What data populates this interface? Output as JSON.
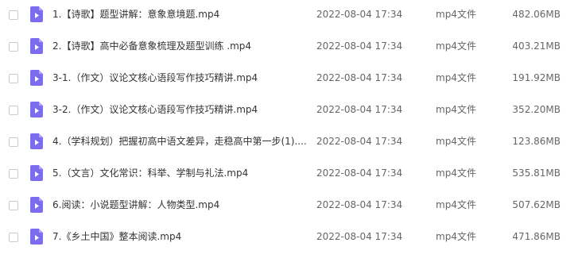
{
  "file_list": {
    "icon": "video-file-icon",
    "icon_color": "#7b6cf0",
    "rows": [
      {
        "name": "1.【诗歌】题型讲解：意象意境题.mp4",
        "date": "2022-08-04 17:34",
        "type": "mp4文件",
        "size": "482.06MB"
      },
      {
        "name": "2.【诗歌】高中必备意象梳理及题型训练 .mp4",
        "date": "2022-08-04 17:34",
        "type": "mp4文件",
        "size": "403.21MB"
      },
      {
        "name": "3-1.（作文）议论文核心语段写作技巧精讲.mp4",
        "date": "2022-08-04 17:34",
        "type": "mp4文件",
        "size": "191.92MB"
      },
      {
        "name": "3-2.（作文）议论文核心语段写作技巧精讲.mp4",
        "date": "2022-08-04 17:34",
        "type": "mp4文件",
        "size": "352.20MB"
      },
      {
        "name": "4.（学科规划）把握初高中语文差异，走稳高中第一步(1)....",
        "date": "2022-08-04 17:34",
        "type": "mp4文件",
        "size": "123.86MB"
      },
      {
        "name": "5.（文言）文化常识：科举、学制与礼法.mp4",
        "date": "2022-08-04 17:34",
        "type": "mp4文件",
        "size": "535.81MB"
      },
      {
        "name": "6.阅读：小说题型讲解：人物类型.mp4",
        "date": "2022-08-04 17:34",
        "type": "mp4文件",
        "size": "507.62MB"
      },
      {
        "name": "7.《乡土中国》整本阅读.mp4",
        "date": "2022-08-04 17:34",
        "type": "mp4文件",
        "size": "471.86MB"
      }
    ]
  }
}
